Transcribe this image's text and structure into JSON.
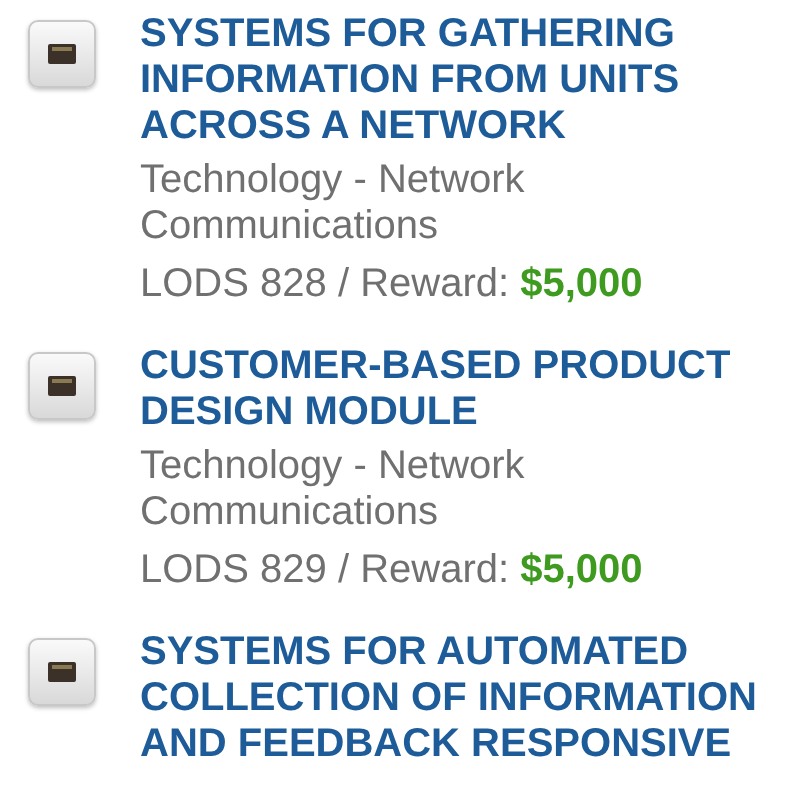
{
  "listings": [
    {
      "title": "SYSTEMS FOR GATHERING INFORMATION FROM UNITS ACROSS A NETWORK",
      "category": "Technology - Network Communications",
      "code": "LODS 828",
      "separator": "/",
      "reward_label": "Reward:",
      "reward": "$5,000"
    },
    {
      "title": "CUSTOMER-BASED PRODUCT DESIGN MODULE",
      "category": "Technology - Network Communications",
      "code": "LODS 829",
      "separator": "/",
      "reward_label": "Reward:",
      "reward": "$5,000"
    },
    {
      "title": "SYSTEMS FOR AUTOMATED COLLECTION OF INFORMATION AND FEEDBACK RESPONSIVE"
    }
  ]
}
